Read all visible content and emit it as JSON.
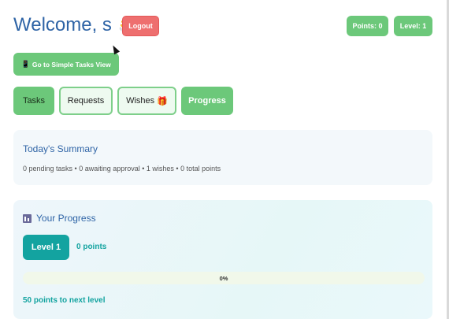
{
  "header": {
    "welcome": "Welcome, s",
    "wave_icon": "👋",
    "logout": "Logout"
  },
  "stats": {
    "points": "Points: 0",
    "level": "Level: 1"
  },
  "simple_view": {
    "icon": "📱",
    "label": "Go to Simple Tasks View"
  },
  "tabs": [
    {
      "label": "Tasks",
      "state": "active"
    },
    {
      "label": "Requests",
      "state": "outline"
    },
    {
      "label": "Wishes",
      "icon": "🎁",
      "state": "outline"
    },
    {
      "label": "Progress",
      "state": "green"
    }
  ],
  "summary": {
    "title": "Today's Summary",
    "text": "0 pending tasks • 0 awaiting approval • 1 wishes • 0 total points"
  },
  "progress": {
    "title": "Your Progress",
    "level": "Level 1",
    "points": "0 points",
    "percent_label": "0%",
    "fill_fraction": 0,
    "next_level": "50 points to next level"
  },
  "colors": {
    "accent_green": "#6cc87a",
    "logout_red": "#ee6f6f",
    "title_blue": "#2f64a6",
    "teal": "#13a3a0"
  }
}
